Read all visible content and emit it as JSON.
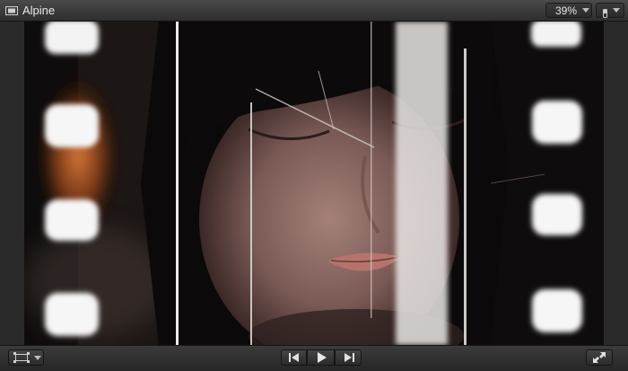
{
  "window": {
    "title": "Alpine",
    "zoom": "39%"
  },
  "icons": {
    "title": "filmstrip-viewer-icon",
    "zoom_menu": "chevron-down-icon",
    "view": "switch-toggle-icon",
    "view_menu": "chevron-down-icon",
    "crop": "transform-crop-icon",
    "crop_menu": "chevron-down-icon",
    "prev": "previous-edit-icon",
    "play": "play-icon",
    "next": "next-edit-icon",
    "fullscreen": "fullscreen-expand-icon"
  },
  "colors": {
    "chrome_dark": "#2a2a2a",
    "text": "#e6e6e6"
  }
}
